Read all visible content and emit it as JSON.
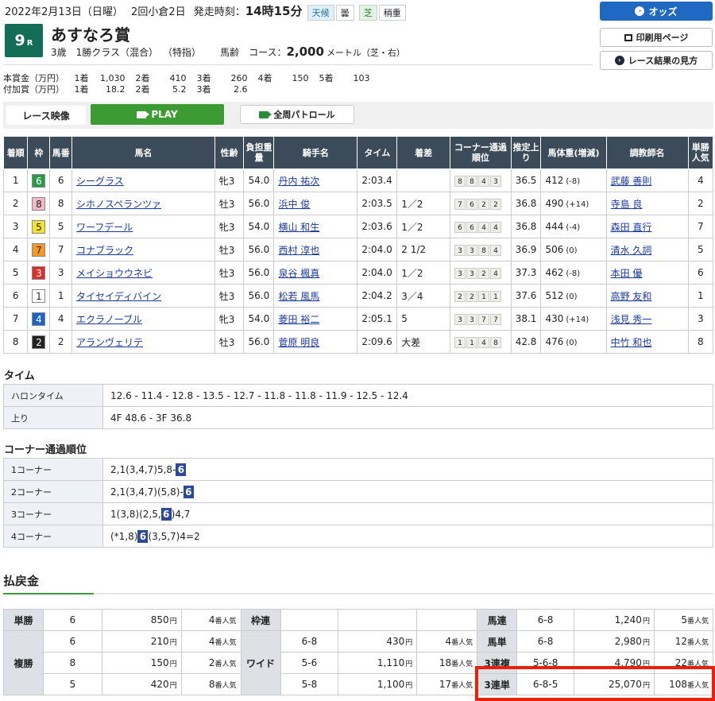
{
  "header": {
    "date": "2022年2月13日（日曜）",
    "kai": "2回小倉2日",
    "start_label": "発走時刻：",
    "start_time": "14時15分",
    "weather_label": "天候",
    "weather": "曇",
    "surface_label": "芝",
    "condition": "稍重"
  },
  "race": {
    "num": "9",
    "num_suffix": "R",
    "name": "あすなろ賞",
    "age": "3歳",
    "cls": "1勝クラス（混合）",
    "special": "（特指）",
    "weight_rule": "馬齢",
    "course_label": "コース：",
    "distance": "2,000",
    "course_suffix": "メートル（芝・右）"
  },
  "buttons": {
    "odds": "オッズ",
    "print": "印刷用ページ",
    "howto": "レース結果の見方"
  },
  "prize": {
    "main_label": "本賞金（万円）",
    "add_label": "付加賞（万円）",
    "main": [
      {
        "p": "1着",
        "v": "1,030"
      },
      {
        "p": "2着",
        "v": "410"
      },
      {
        "p": "3着",
        "v": "260"
      },
      {
        "p": "4着",
        "v": "150"
      },
      {
        "p": "5着",
        "v": "103"
      }
    ],
    "add": [
      {
        "p": "1着",
        "v": "18.2"
      },
      {
        "p": "2着",
        "v": "5.2"
      },
      {
        "p": "3着",
        "v": "2.6"
      }
    ]
  },
  "video": {
    "label": "レース映像",
    "play": "PLAY",
    "patrol": "全周パトロール"
  },
  "results": {
    "headers": {
      "rank": "着順",
      "waku": "枠",
      "num": "馬番",
      "name": "馬名",
      "sex": "性齢",
      "wt": "負担重量",
      "jockey": "騎手名",
      "time": "タイム",
      "margin": "着差",
      "corner": "コーナー通過順位",
      "f3": "推定上り",
      "bw": "馬体重(増減)",
      "trainer": "調教師名",
      "pop": "単勝人気"
    },
    "rows": [
      {
        "rank": "1",
        "waku": "6",
        "num": "6",
        "name": "シーグラス",
        "sex": "牝3",
        "wt": "54.0",
        "jockey": "丹内 祐次",
        "time": "2:03.4",
        "margin": "",
        "c1": "8",
        "c2": "8",
        "c3": "4",
        "c4": "3",
        "f3": "36.5",
        "bw": "412",
        "bwd": "(-8)",
        "trainer": "武藤 善則",
        "pop": "4"
      },
      {
        "rank": "2",
        "waku": "8",
        "num": "8",
        "name": "シホノスペランツァ",
        "sex": "牡3",
        "wt": "56.0",
        "jockey": "浜中 俊",
        "time": "2:03.5",
        "margin": "1／2",
        "c1": "7",
        "c2": "6",
        "c3": "2",
        "c4": "2",
        "f3": "36.8",
        "bw": "490",
        "bwd": "(+14)",
        "trainer": "寺島 良",
        "pop": "2"
      },
      {
        "rank": "3",
        "waku": "5",
        "num": "5",
        "name": "ワーフデール",
        "sex": "牝3",
        "wt": "54.0",
        "jockey": "横山 和生",
        "time": "2:03.6",
        "margin": "1／2",
        "c1": "6",
        "c2": "6",
        "c3": "4",
        "c4": "4",
        "f3": "36.8",
        "bw": "444",
        "bwd": "(-4)",
        "trainer": "森田 直行",
        "pop": "7"
      },
      {
        "rank": "4",
        "waku": "7",
        "num": "7",
        "name": "コナブラック",
        "sex": "牡3",
        "wt": "56.0",
        "jockey": "西村 淳也",
        "time": "2:04.0",
        "margin": "2 1/2",
        "c1": "3",
        "c2": "3",
        "c3": "8",
        "c4": "4",
        "f3": "36.9",
        "bw": "506",
        "bwd": "(0)",
        "trainer": "清水 久詞",
        "pop": "5"
      },
      {
        "rank": "5",
        "waku": "3",
        "num": "3",
        "name": "メイショウウネビ",
        "sex": "牡3",
        "wt": "56.0",
        "jockey": "泉谷 楓真",
        "time": "2:04.0",
        "margin": "1／2",
        "c1": "3",
        "c2": "3",
        "c3": "2",
        "c4": "4",
        "f3": "37.3",
        "bw": "462",
        "bwd": "(-8)",
        "trainer": "本田 優",
        "pop": "6"
      },
      {
        "rank": "6",
        "waku": "1",
        "num": "1",
        "name": "タイセイディバイン",
        "sex": "牡3",
        "wt": "56.0",
        "jockey": "松若 風馬",
        "time": "2:04.2",
        "margin": "3／4",
        "c1": "2",
        "c2": "2",
        "c3": "1",
        "c4": "1",
        "f3": "37.6",
        "bw": "512",
        "bwd": "(0)",
        "trainer": "高野 友和",
        "pop": "1"
      },
      {
        "rank": "7",
        "waku": "4",
        "num": "4",
        "name": "エクラノーブル",
        "sex": "牝3",
        "wt": "54.0",
        "jockey": "菱田 裕二",
        "time": "2:05.1",
        "margin": "5",
        "c1": "3",
        "c2": "3",
        "c3": "7",
        "c4": "7",
        "f3": "38.1",
        "bw": "430",
        "bwd": "(+14)",
        "trainer": "浅見 秀一",
        "pop": "3"
      },
      {
        "rank": "8",
        "waku": "2",
        "num": "2",
        "name": "アランヴェリテ",
        "sex": "牡3",
        "wt": "56.0",
        "jockey": "菅原 明良",
        "time": "2:09.6",
        "margin": "大差",
        "c1": "1",
        "c2": "1",
        "c3": "4",
        "c4": "8",
        "f3": "42.8",
        "bw": "476",
        "bwd": "(0)",
        "trainer": "中竹 和也",
        "pop": "8"
      }
    ]
  },
  "waku_colors": {
    "1": [
      "#ffffff",
      "#222222"
    ],
    "2": [
      "#222222",
      "#ffffff"
    ],
    "3": [
      "#d8312b",
      "#ffffff"
    ],
    "4": [
      "#1e64c8",
      "#ffffff"
    ],
    "5": [
      "#f3e32b",
      "#222222"
    ],
    "6": [
      "#2b9a48",
      "#ffffff"
    ],
    "7": [
      "#f39a25",
      "#222222"
    ],
    "8": [
      "#f4b9c8",
      "#222222"
    ]
  },
  "times": {
    "title": "タイム",
    "halon_label": "ハロンタイム",
    "halon": "12.6 - 11.4 - 12.8 - 13.5 - 12.7 - 11.8 - 11.8 - 11.9 - 12.5 - 12.4",
    "agari_label": "上り",
    "agari": "4F 48.6 - 3F 36.8"
  },
  "corners": {
    "title": "コーナー通過順位",
    "rows": [
      {
        "label": "1コーナー",
        "pre": "2,1(3,4,7)5,8-",
        "hl": "6",
        "post": ""
      },
      {
        "label": "2コーナー",
        "pre": "2,1(3,4,7)(5,8)-",
        "hl": "6",
        "post": ""
      },
      {
        "label": "3コーナー",
        "pre": "1(3,8)(2,5,",
        "hl": "6",
        "post": ")4,7"
      },
      {
        "label": "4コーナー",
        "pre": "(*1,8)",
        "hl": "6",
        "post": "(3,5,7)4=2"
      }
    ]
  },
  "payout": {
    "title": "払戻金",
    "yen": "円",
    "ninki": "番人気",
    "tansho": {
      "label": "単勝",
      "combo": "6",
      "amt": "850",
      "pop": "4"
    },
    "fukusho": {
      "label": "複勝",
      "rows": [
        {
          "combo": "6",
          "amt": "210",
          "pop": "4"
        },
        {
          "combo": "8",
          "amt": "150",
          "pop": "2"
        },
        {
          "combo": "5",
          "amt": "420",
          "pop": "8"
        }
      ]
    },
    "wakuren": {
      "label": "枠連"
    },
    "wide": {
      "label": "ワイド",
      "rows": [
        {
          "combo": "6-8",
          "amt": "430",
          "pop": "4"
        },
        {
          "combo": "5-6",
          "amt": "1,110",
          "pop": "18"
        },
        {
          "combo": "5-8",
          "amt": "1,100",
          "pop": "17"
        }
      ]
    },
    "umaren": {
      "label": "馬連",
      "combo": "6-8",
      "amt": "1,240",
      "pop": "5"
    },
    "umatan": {
      "label": "馬単",
      "combo": "6-8",
      "amt": "2,980",
      "pop": "12"
    },
    "sanrenpuku": {
      "label": "3連複",
      "combo": "5-6-8",
      "amt": "4,790",
      "pop": "22"
    },
    "sanrentan": {
      "label": "3連単",
      "combo": "6-8-5",
      "amt": "25,070",
      "pop": "108"
    }
  }
}
